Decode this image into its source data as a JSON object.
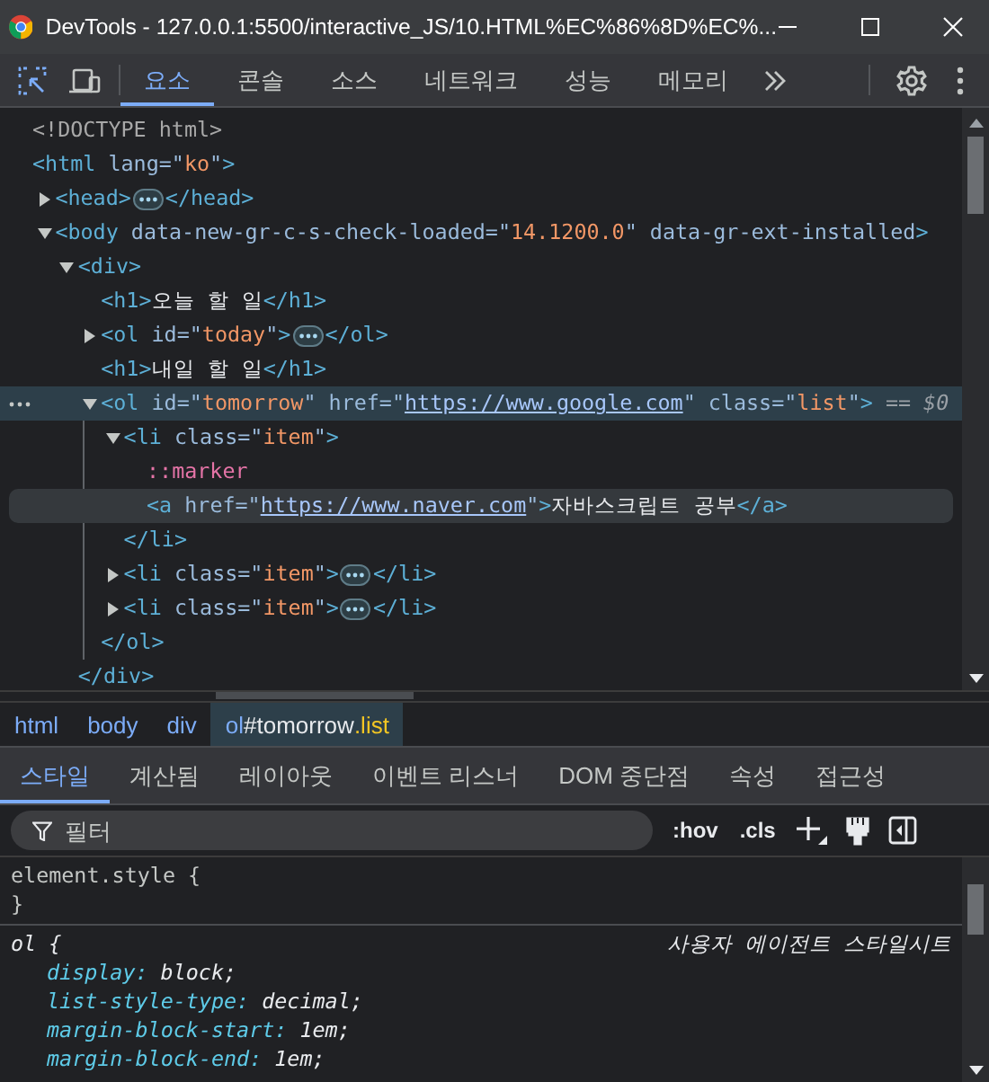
{
  "window": {
    "title": "DevTools - 127.0.0.1:5500/interactive_JS/10.HTML%EC%86%8D%EC%..."
  },
  "panel_tabs": [
    {
      "label": "요소",
      "selected": true
    },
    {
      "label": "콘솔",
      "selected": false
    },
    {
      "label": "소스",
      "selected": false
    },
    {
      "label": "네트워크",
      "selected": false
    },
    {
      "label": "성능",
      "selected": false
    },
    {
      "label": "메모리",
      "selected": false
    }
  ],
  "dom_tree": [
    {
      "selected": false,
      "hovered": false,
      "parts": [
        {
          "kind": "doctype",
          "text": "<!DOCTYPE html>"
        }
      ]
    },
    {
      "selected": false,
      "hovered": false,
      "parts": [
        {
          "kind": "tag",
          "text": "<html"
        },
        {
          "kind": "attr",
          "text": " lang=\""
        },
        {
          "kind": "value",
          "text": "ko"
        },
        {
          "kind": "attr",
          "text": "\""
        },
        {
          "kind": "tag",
          "text": ">"
        }
      ],
      "children": [
        {
          "selected": false,
          "hovered": false,
          "expanded": false,
          "parts": [
            {
              "kind": "tag",
              "text": "<head>"
            },
            {
              "kind": "ellipsis"
            },
            {
              "kind": "tag",
              "text": "</head>"
            }
          ]
        },
        {
          "selected": false,
          "hovered": false,
          "expanded": true,
          "parts": [
            {
              "kind": "tag",
              "text": "<body"
            },
            {
              "kind": "attr",
              "text": " data-new-gr-c-s-check-loaded=\""
            },
            {
              "kind": "value",
              "text": "14.1200.0"
            },
            {
              "kind": "attr",
              "text": "\" data-gr-ext-installed"
            },
            {
              "kind": "tag",
              "text": ">"
            }
          ],
          "children": [
            {
              "selected": false,
              "hovered": false,
              "expanded": true,
              "parts": [
                {
                  "kind": "tag",
                  "text": "<div>"
                }
              ],
              "closing": [
                {
                  "kind": "tag",
                  "text": "</div>"
                }
              ],
              "children": [
                {
                  "selected": false,
                  "hovered": false,
                  "parts": [
                    {
                      "kind": "tag",
                      "text": "<h1>"
                    },
                    {
                      "kind": "text",
                      "text": "오늘 할 일"
                    },
                    {
                      "kind": "tag",
                      "text": "</h1>"
                    }
                  ]
                },
                {
                  "selected": false,
                  "hovered": false,
                  "expanded": false,
                  "parts": [
                    {
                      "kind": "tag",
                      "text": "<ol"
                    },
                    {
                      "kind": "attr",
                      "text": " id=\""
                    },
                    {
                      "kind": "value",
                      "text": "today"
                    },
                    {
                      "kind": "attr",
                      "text": "\""
                    },
                    {
                      "kind": "tag",
                      "text": ">"
                    },
                    {
                      "kind": "ellipsis"
                    },
                    {
                      "kind": "tag",
                      "text": "</ol>"
                    }
                  ]
                },
                {
                  "selected": false,
                  "hovered": false,
                  "parts": [
                    {
                      "kind": "tag",
                      "text": "<h1>"
                    },
                    {
                      "kind": "text",
                      "text": "내일 할 일"
                    },
                    {
                      "kind": "tag",
                      "text": "</h1>"
                    }
                  ]
                },
                {
                  "selected": true,
                  "hovered": false,
                  "expanded": true,
                  "parts": [
                    {
                      "kind": "tag",
                      "text": "<ol"
                    },
                    {
                      "kind": "attr",
                      "text": " id=\""
                    },
                    {
                      "kind": "value",
                      "text": "tomorrow"
                    },
                    {
                      "kind": "attr",
                      "text": "\" href=\""
                    },
                    {
                      "kind": "link",
                      "text": "https://www.google.com"
                    },
                    {
                      "kind": "attr",
                      "text": "\" class=\""
                    },
                    {
                      "kind": "value",
                      "text": "list"
                    },
                    {
                      "kind": "attr",
                      "text": "\""
                    },
                    {
                      "kind": "tag",
                      "text": ">"
                    },
                    {
                      "kind": "note",
                      "text": " == $0"
                    }
                  ],
                  "closing": [
                    {
                      "kind": "tag",
                      "text": "</ol>"
                    }
                  ],
                  "children": [
                    {
                      "selected": false,
                      "hovered": false,
                      "expanded": true,
                      "parts": [
                        {
                          "kind": "tag",
                          "text": "<li"
                        },
                        {
                          "kind": "attr",
                          "text": " class=\""
                        },
                        {
                          "kind": "value",
                          "text": "item"
                        },
                        {
                          "kind": "attr",
                          "text": "\""
                        },
                        {
                          "kind": "tag",
                          "text": ">"
                        }
                      ],
                      "closing": [
                        {
                          "kind": "tag",
                          "text": "</li>"
                        }
                      ],
                      "children": [
                        {
                          "selected": false,
                          "hovered": false,
                          "parts": [
                            {
                              "kind": "pseudo",
                              "text": "::marker"
                            }
                          ]
                        },
                        {
                          "selected": false,
                          "hovered": true,
                          "parts": [
                            {
                              "kind": "tag",
                              "text": "<a"
                            },
                            {
                              "kind": "attr",
                              "text": " href=\""
                            },
                            {
                              "kind": "link",
                              "text": "https://www.naver.com"
                            },
                            {
                              "kind": "attr",
                              "text": "\""
                            },
                            {
                              "kind": "tag",
                              "text": ">"
                            },
                            {
                              "kind": "text",
                              "text": "자바스크립트 공부"
                            },
                            {
                              "kind": "tag",
                              "text": "</a>"
                            }
                          ]
                        }
                      ]
                    },
                    {
                      "selected": false,
                      "hovered": false,
                      "expanded": false,
                      "parts": [
                        {
                          "kind": "tag",
                          "text": "<li"
                        },
                        {
                          "kind": "attr",
                          "text": " class=\""
                        },
                        {
                          "kind": "value",
                          "text": "item"
                        },
                        {
                          "kind": "attr",
                          "text": "\""
                        },
                        {
                          "kind": "tag",
                          "text": ">"
                        },
                        {
                          "kind": "ellipsis"
                        },
                        {
                          "kind": "tag",
                          "text": "</li>"
                        }
                      ]
                    },
                    {
                      "selected": false,
                      "hovered": false,
                      "expanded": false,
                      "parts": [
                        {
                          "kind": "tag",
                          "text": "<li"
                        },
                        {
                          "kind": "attr",
                          "text": " class=\""
                        },
                        {
                          "kind": "value",
                          "text": "item"
                        },
                        {
                          "kind": "attr",
                          "text": "\""
                        },
                        {
                          "kind": "tag",
                          "text": ">"
                        },
                        {
                          "kind": "ellipsis"
                        },
                        {
                          "kind": "tag",
                          "text": "</li>"
                        }
                      ]
                    }
                  ]
                }
              ]
            }
          ]
        }
      ]
    }
  ],
  "breadcrumbs": [
    {
      "selected": false,
      "parts": [
        {
          "kind": "tag",
          "text": "html"
        }
      ]
    },
    {
      "selected": false,
      "parts": [
        {
          "kind": "tag",
          "text": "body"
        }
      ]
    },
    {
      "selected": false,
      "parts": [
        {
          "kind": "tag",
          "text": "div"
        }
      ]
    },
    {
      "selected": true,
      "parts": [
        {
          "kind": "tag",
          "text": "ol"
        },
        {
          "kind": "id",
          "text": "#tomorrow"
        },
        {
          "kind": "class",
          "text": ".list"
        }
      ]
    }
  ],
  "sidebar_tabs": [
    {
      "label": "스타일",
      "selected": true
    },
    {
      "label": "계산됨",
      "selected": false
    },
    {
      "label": "레이아웃",
      "selected": false
    },
    {
      "label": "이벤트 리스너",
      "selected": false
    },
    {
      "label": "DOM 중단점",
      "selected": false
    },
    {
      "label": "속성",
      "selected": false
    },
    {
      "label": "접근성",
      "selected": false
    }
  ],
  "styles_toolbar": {
    "filter": {
      "placeholder": "필터"
    },
    "buttons": [
      ":hov",
      ".cls"
    ]
  },
  "style_rules": [
    {
      "selector": "element.style {",
      "user_agent": false,
      "closing": "}"
    },
    {
      "selector": "ol {",
      "user_agent": true,
      "source": "사용자 에이전트 스타일시트",
      "declarations": [
        {
          "property": "display:",
          "value": "block;"
        },
        {
          "property": "list-style-type:",
          "value": "decimal;"
        },
        {
          "property": "margin-block-start:",
          "value": "1em;"
        },
        {
          "property": "margin-block-end:",
          "value": "1em;"
        }
      ]
    }
  ]
}
